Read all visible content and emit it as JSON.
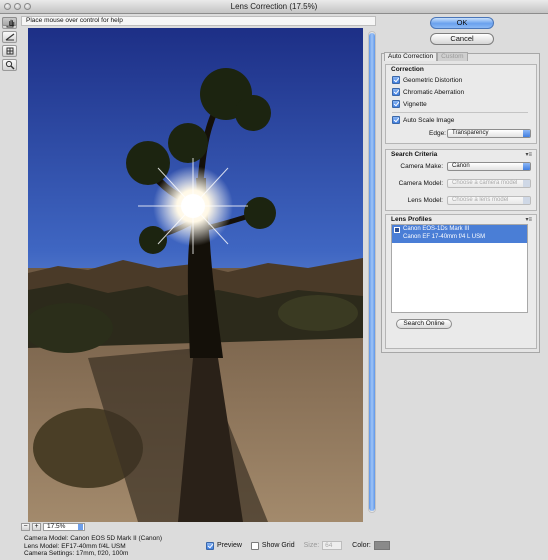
{
  "window": {
    "title": "Lens Correction (17.5%)"
  },
  "help": {
    "text": "Place mouse over control for help"
  },
  "tools": [
    {
      "icon": "remove-distortion-icon"
    },
    {
      "icon": "straighten-icon"
    },
    {
      "icon": "move-grid-icon"
    },
    {
      "icon": "hand-icon"
    },
    {
      "icon": "zoom-icon"
    }
  ],
  "buttons": {
    "ok": "OK",
    "cancel": "Cancel"
  },
  "tabs": {
    "auto": "Auto Correction",
    "custom": "Custom"
  },
  "correction": {
    "title": "Correction",
    "geometric": "Geometric Distortion",
    "chromatic": "Chromatic Aberration",
    "vignette": "Vignette",
    "auto_scale": "Auto Scale Image",
    "edge_label": "Edge:",
    "edge_value": "Transparency"
  },
  "search": {
    "title": "Search Criteria",
    "make_label": "Camera Make:",
    "make_value": "Canon",
    "model_label": "Camera Model:",
    "model_placeholder": "Choose a camera model",
    "lens_label": "Lens Model:",
    "lens_placeholder": "Choose a lens model"
  },
  "profiles": {
    "title": "Lens Profiles",
    "line1": "Canon EOS-1Ds Mark III",
    "line2": "Canon EF 17-40mm f/4 L USM",
    "search_online": "Search Online"
  },
  "zoom": {
    "minus": "−",
    "plus": "+",
    "value": "17.5%"
  },
  "info": {
    "camera_model": "Camera Model: Canon EOS 5D Mark II (Canon)",
    "lens_model": "Lens Model: EF17-40mm f/4L USM",
    "settings": "Camera Settings: 17mm, f/20, 100m"
  },
  "bottom": {
    "preview": "Preview",
    "show_grid": "Show Grid",
    "size_label": "Size:",
    "size_value": "64",
    "color_label": "Color:"
  },
  "colors": {
    "accent": "#4a7ed6",
    "swatch": "#8a8a8a"
  }
}
